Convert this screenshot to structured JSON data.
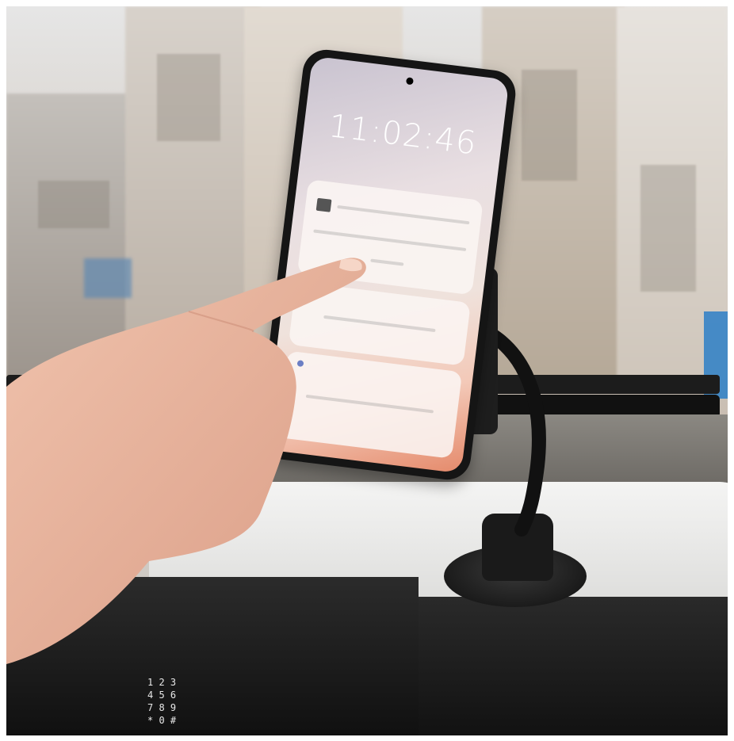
{
  "image": {
    "alt": "Hand tapping a smartphone mounted on a car dashboard with a gooseneck suction-cup holder"
  },
  "colors": {
    "skin": "#e9b39c",
    "mount": "#1a1a1a",
    "dashboard": "#e4e4e2"
  }
}
